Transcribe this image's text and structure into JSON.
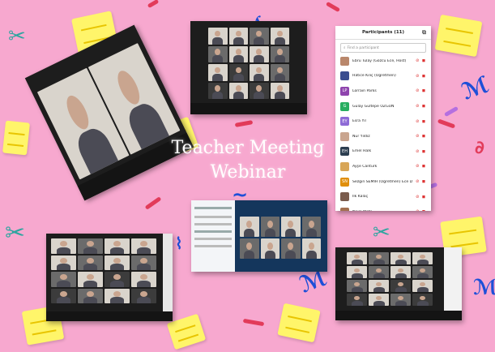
{
  "title": {
    "line1": "Teacher Meeting",
    "line2": "Webinar"
  },
  "colors": {
    "background": "#f7a8cf",
    "sticky_note": "#fff56a",
    "squiggle_blue": "#1e4fd8",
    "squiggle_green": "#2fa5a0",
    "dash_red": "#e23b5a",
    "dash_purple": "#b46fe0"
  },
  "participants_panel": {
    "header": "Participants (11)",
    "search_placeholder": "Find a participant",
    "participants": [
      {
        "initials": "",
        "name": "Ebru Tülay (Gözcü Ece, Host)",
        "avatar_color": "#b9876b"
      },
      {
        "initials": "",
        "name": "Hatice Kılıç (Ögretmen)",
        "avatar_color": "#3a4d8f"
      },
      {
        "initials": "LP",
        "name": "Lorrain Parks",
        "avatar_color": "#8e44ad"
      },
      {
        "initials": "G",
        "name": "Gülay Gültepe ÖZGÜN",
        "avatar_color": "#27ae60"
      },
      {
        "initials": "EY",
        "name": "Esra Yıl",
        "avatar_color": "#8e6bd6"
      },
      {
        "initials": "",
        "name": "Nur Yıldız",
        "avatar_color": "#c9a58f"
      },
      {
        "initials": "EH",
        "name": "Emel Halk",
        "avatar_color": "#2c3e50"
      },
      {
        "initials": "",
        "name": "Ayşe Cantürk",
        "avatar_color": "#d8a657"
      },
      {
        "initials": "SN",
        "name": "Sezgin SEMİH (Ögretmen) Ece D.",
        "avatar_color": "#e08e0b"
      },
      {
        "initials": "",
        "name": "İlk Kalaç",
        "avatar_color": "#7a5c4d"
      },
      {
        "initials": "",
        "name": "Naile Mete",
        "avatar_color": "#a26f4f"
      }
    ]
  }
}
